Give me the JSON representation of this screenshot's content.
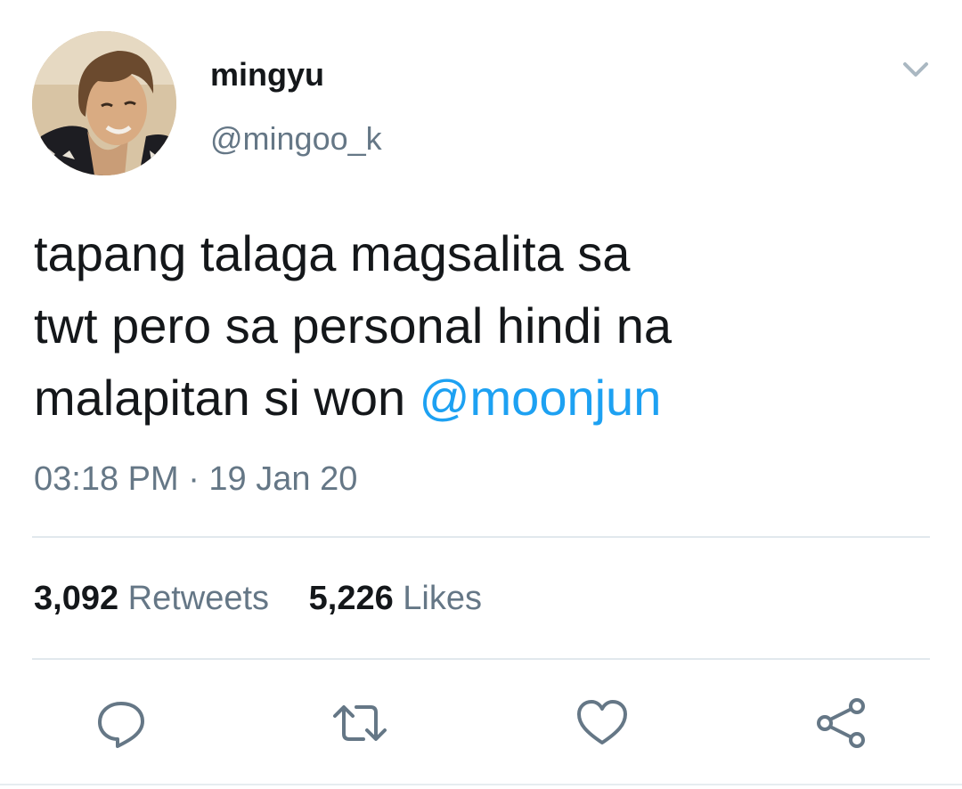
{
  "author": {
    "display_name": "mingyu",
    "handle": "@mingoo_k",
    "avatar_icon": "profile-photo"
  },
  "tweet": {
    "lines": [
      "tapang talaga magsalita sa",
      "twt pero sa personal hindi na",
      "malapitan si won "
    ],
    "mention": "@moonjun",
    "timestamp": "03:18 PM · 19 Jan 20"
  },
  "stats": {
    "retweets_count": "3,092",
    "retweets_label": "Retweets",
    "likes_count": "5,226",
    "likes_label": "Likes"
  },
  "actions": [
    {
      "icon": "reply-icon"
    },
    {
      "icon": "retweet-icon"
    },
    {
      "icon": "like-heart-icon"
    },
    {
      "icon": "share-icon"
    }
  ],
  "colors": {
    "accent": "#1da1f2",
    "text": "#14171a",
    "muted": "#657786",
    "divider": "#e1e8ed",
    "icon": "#657786"
  }
}
